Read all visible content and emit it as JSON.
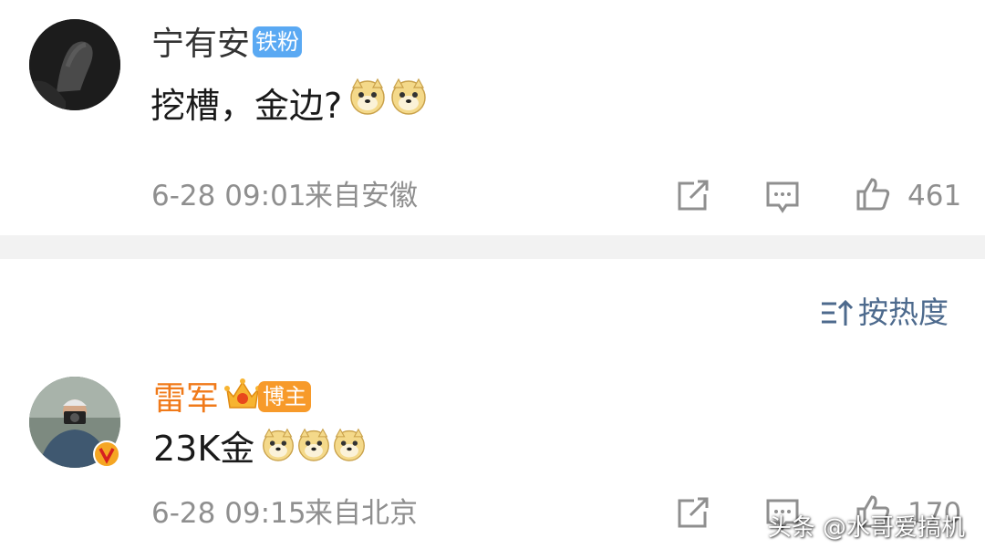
{
  "comments": [
    {
      "username": "宁有安",
      "badge": "铁粉",
      "text": "挖槽，金边?",
      "emoji_icon": "doge-emoji-icon",
      "emoji_count": 2,
      "time": "6-28 09:01",
      "location": "来自安徽",
      "likes": "461"
    },
    {
      "username": "雷军",
      "badge": "博主",
      "text": "23K金",
      "emoji_icon": "doge-emoji-icon",
      "emoji_count": 3,
      "time": "6-28 09:15",
      "location": "来自北京",
      "likes": "170"
    }
  ],
  "sort": {
    "label": "按热度",
    "icon": "sort-icon"
  },
  "watermark": "头条 @水哥爱搞机",
  "colors": {
    "badge_fan": "#5aa9f3",
    "badge_owner": "#f79a2a",
    "username_owner": "#f07a1a",
    "sort_text": "#4d6a8d"
  }
}
